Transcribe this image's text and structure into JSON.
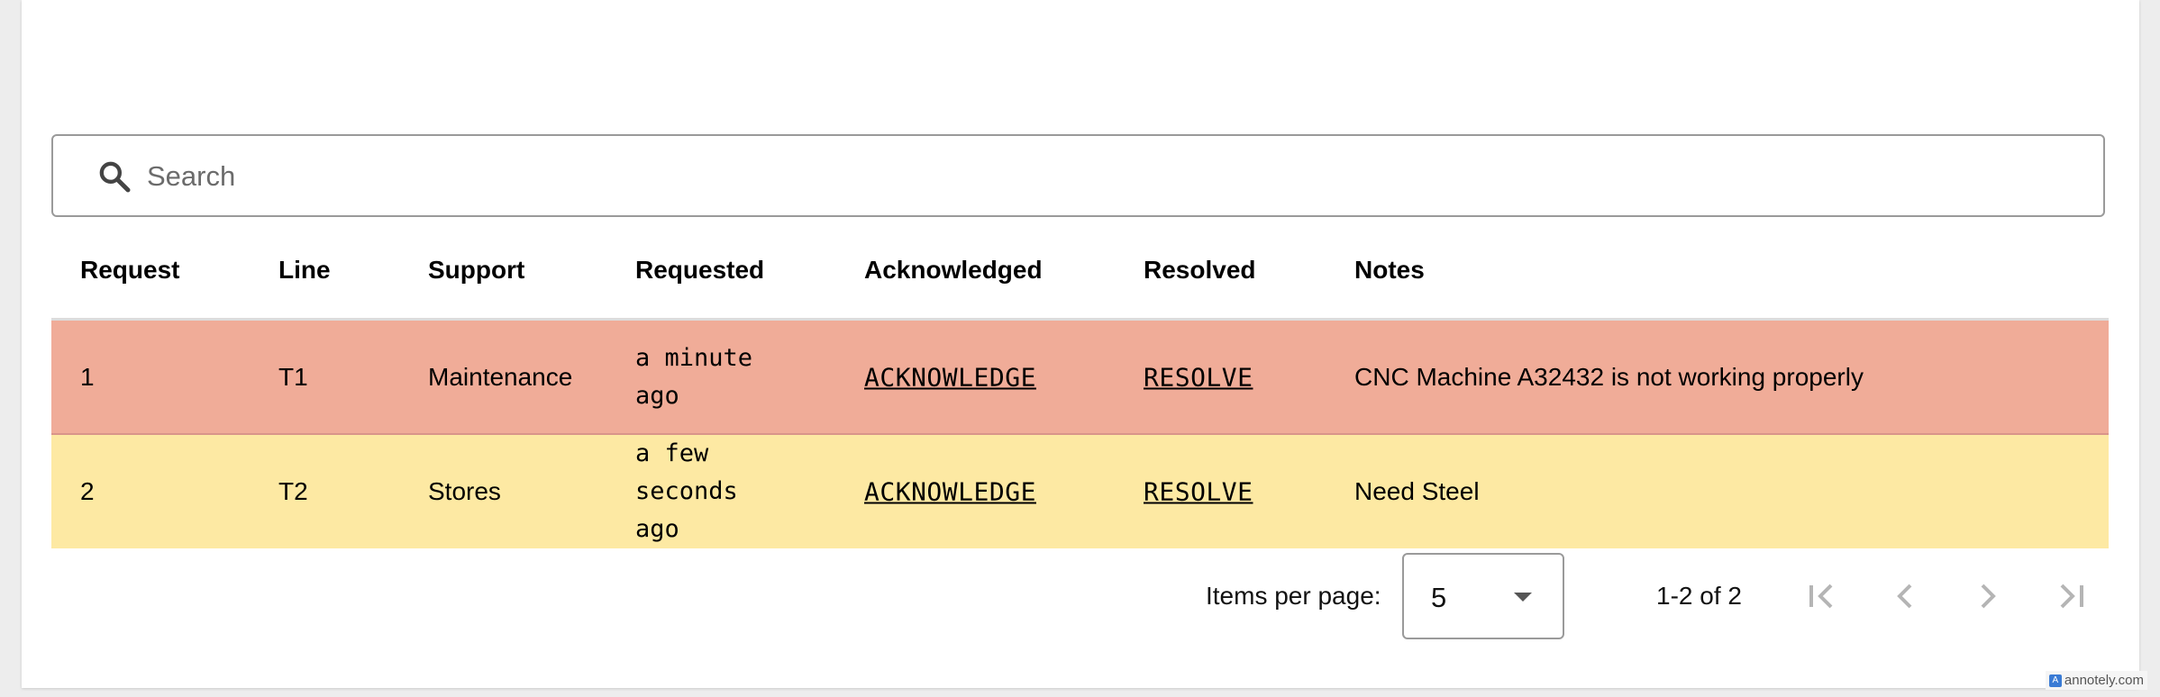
{
  "search": {
    "placeholder": "Search",
    "icon": "search-icon"
  },
  "table": {
    "headers": {
      "request": "Request",
      "line": "Line",
      "support": "Support",
      "requested": "Requested",
      "acknowledged": "Acknowledged",
      "resolved": "Resolved",
      "notes": "Notes"
    },
    "rows": [
      {
        "request": "1",
        "line": "T1",
        "support": "Maintenance",
        "requested": "a minute ago",
        "acknowledge_label": "ACKNOWLEDGE",
        "resolve_label": "RESOLVE",
        "notes": "CNC Machine A32432 is not working properly",
        "row_color": "#f0ac98"
      },
      {
        "request": "2",
        "line": "T2",
        "support": "Stores",
        "requested": "a few seconds ago",
        "acknowledge_label": "ACKNOWLEDGE",
        "resolve_label": "RESOLVE",
        "notes": "Need Steel",
        "row_color": "#fde9a3"
      }
    ]
  },
  "paginator": {
    "items_per_page_label": "Items per page:",
    "items_per_page_value": "5",
    "range_label": "1-2 of 2",
    "icons": [
      "first-page-icon",
      "previous-page-icon",
      "next-page-icon",
      "last-page-icon"
    ]
  },
  "watermark": {
    "text": "annotely.com"
  }
}
